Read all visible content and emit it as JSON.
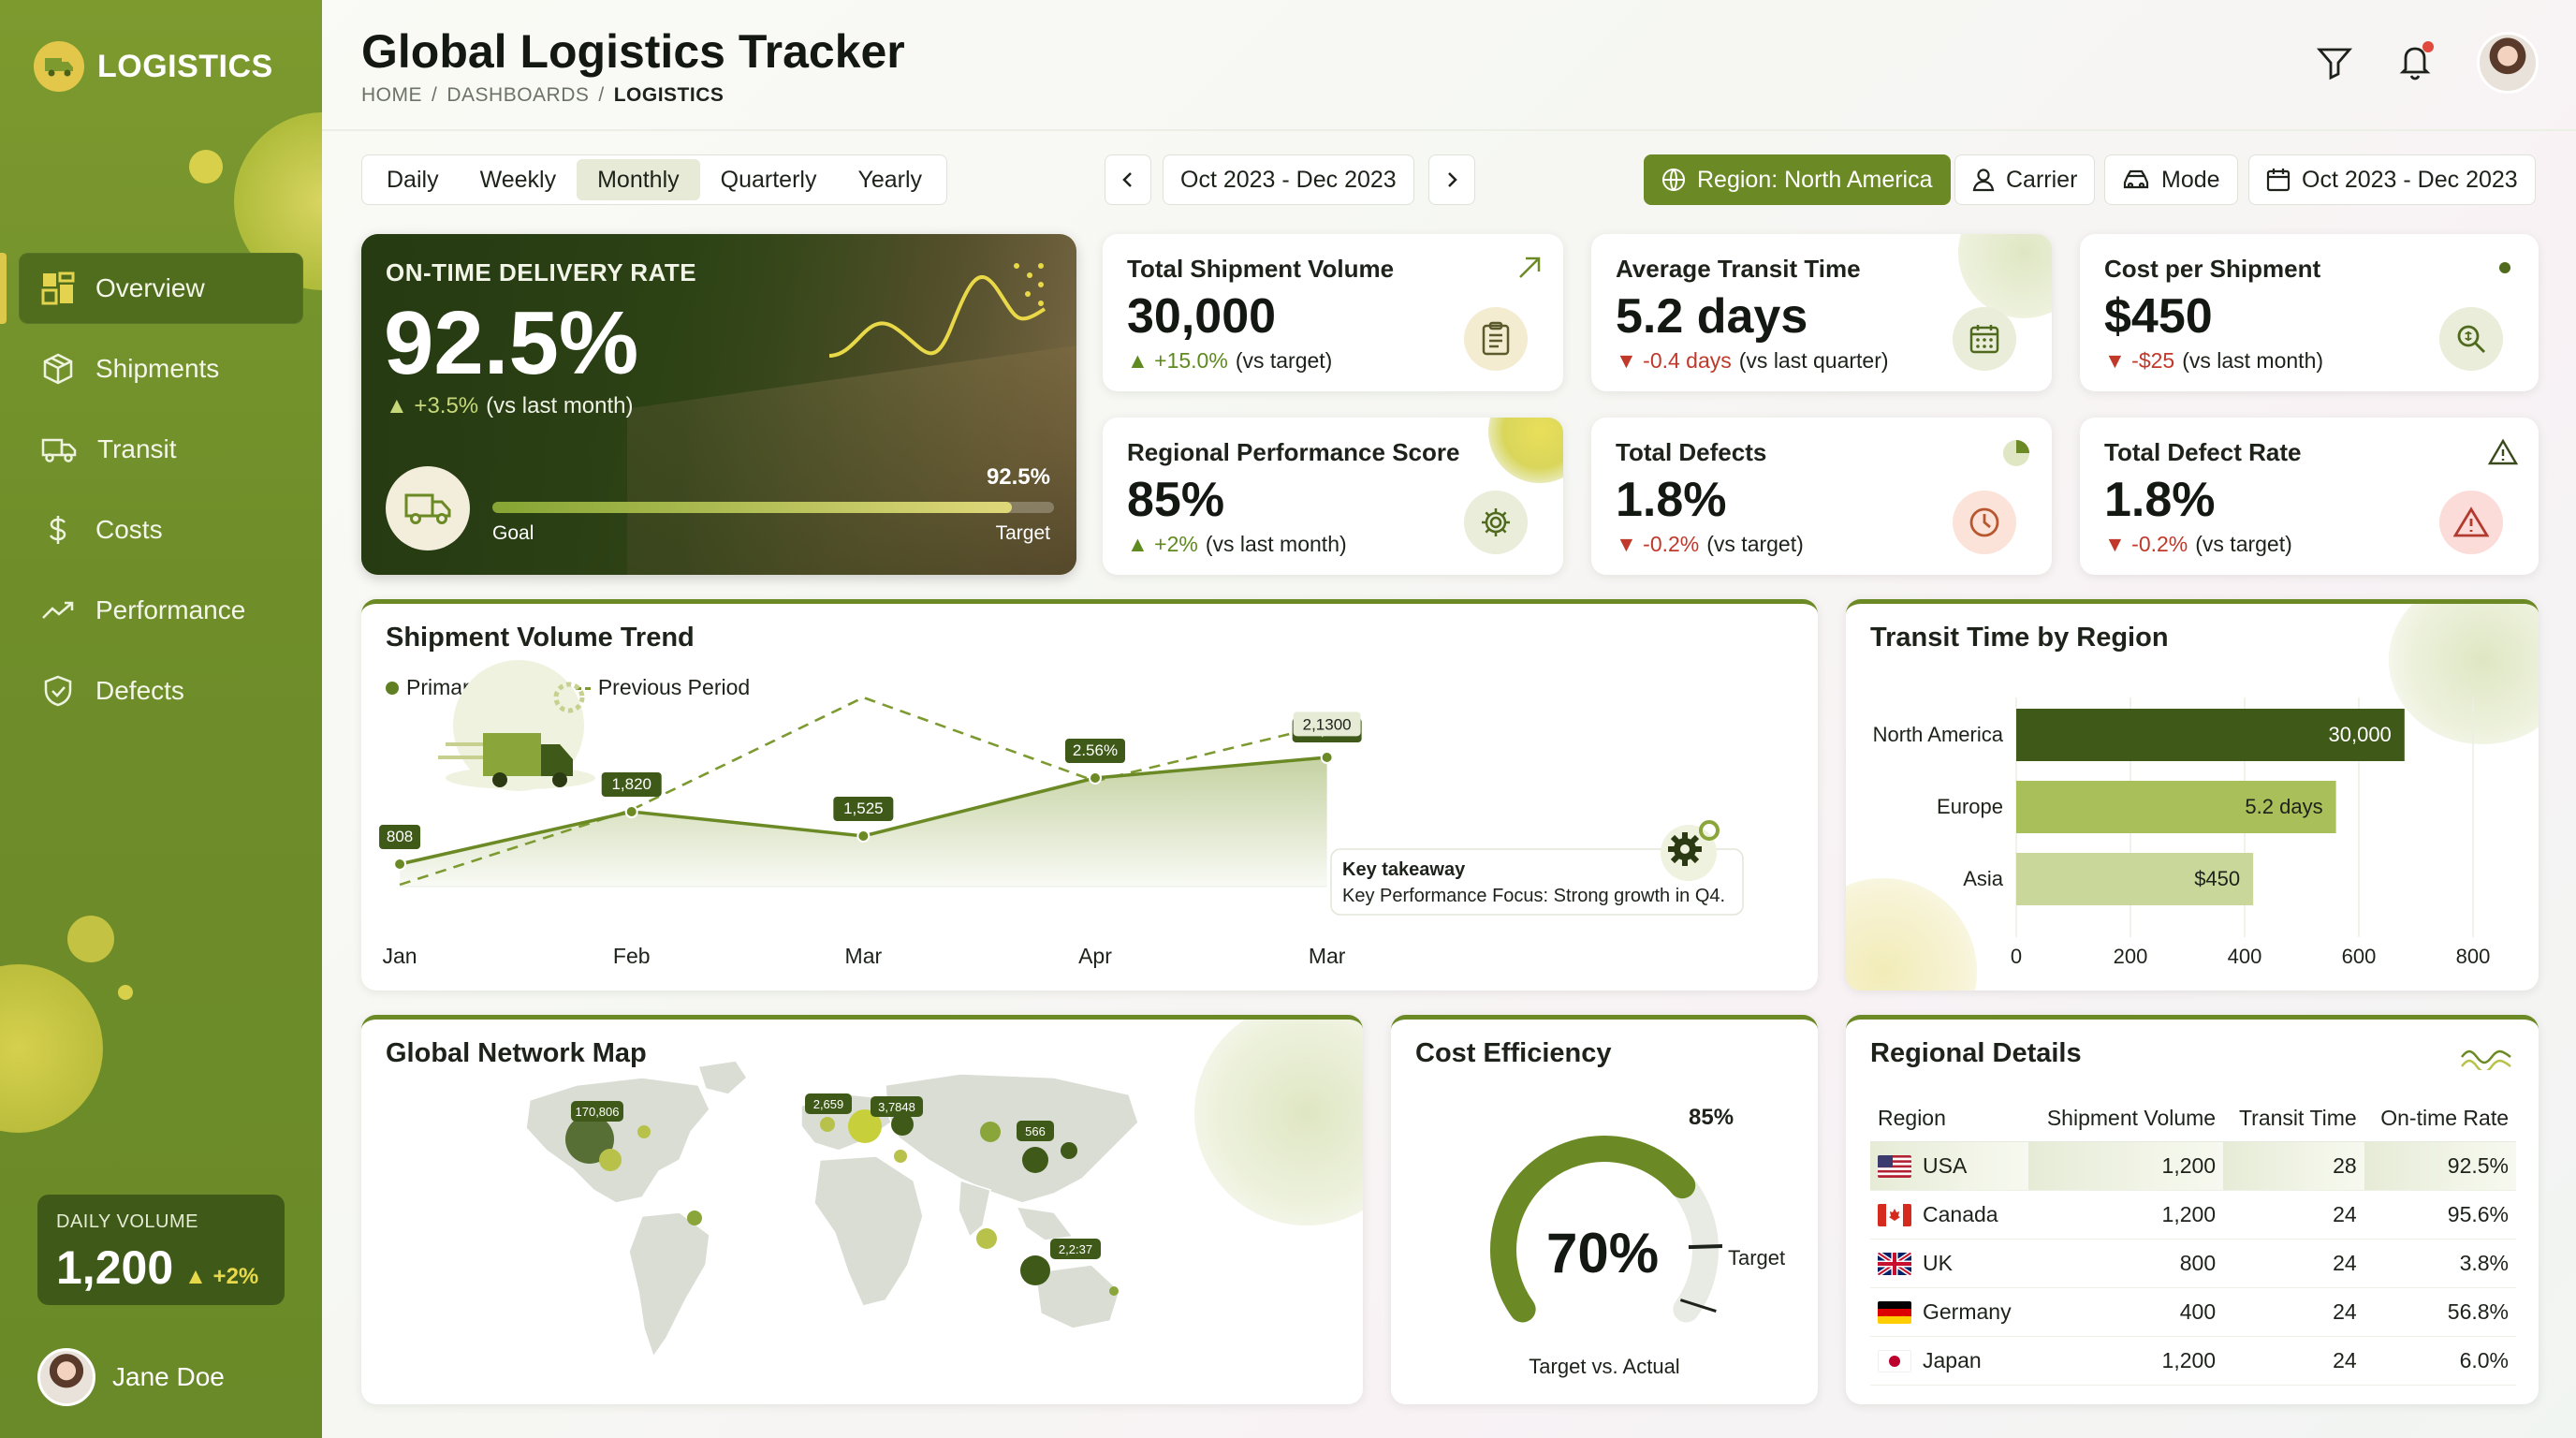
{
  "app": {
    "brand": "LOGISTICS",
    "title": "Global Logistics Tracker",
    "breadcrumb": [
      "HOME",
      "DASHBOARDS",
      "LOGISTICS"
    ]
  },
  "sidebar": {
    "items": [
      {
        "label": "Overview",
        "icon": "grid-icon",
        "active": true
      },
      {
        "label": "Shipments",
        "icon": "box-icon"
      },
      {
        "label": "Transit",
        "icon": "truck-icon"
      },
      {
        "label": "Costs",
        "icon": "dollar-icon"
      },
      {
        "label": "Performance",
        "icon": "trend-icon"
      },
      {
        "label": "Defects",
        "icon": "shield-icon"
      }
    ],
    "daily_volume": {
      "label": "DAILY VOLUME",
      "value": "1,200",
      "delta": "▲ +2%"
    },
    "user": {
      "name": "Jane Doe"
    }
  },
  "filters": {
    "periods": [
      "Daily",
      "Weekly",
      "Monthly",
      "Quarterly",
      "Yearly"
    ],
    "active_period": "Monthly",
    "date_range": "Oct 2023 - Dec 2023",
    "region": "Region: North America",
    "carrier": "Carrier",
    "mode": "Mode",
    "date_range_2": "Oct 2023 - Dec 2023"
  },
  "hero": {
    "title": "ON-TIME DELIVERY RATE",
    "value": "92.5%",
    "delta": "▲ +3.5%",
    "delta_note": "(vs last month)",
    "progress_pct": "92.5%",
    "progress_fraction": 0.925,
    "goal_label": "Goal",
    "target_label": "Target"
  },
  "kpis": {
    "shipment_volume": {
      "title": "Total Shipment Volume",
      "value": "30,000",
      "delta": "▲ +15.0%",
      "note": "(vs target)"
    },
    "transit_time": {
      "title": "Average Transit Time",
      "value": "5.2 days",
      "delta": "▼ -0.4 days",
      "note": "(vs last quarter)"
    },
    "cost_per_shipment": {
      "title": "Cost per Shipment",
      "value": "$450",
      "delta": "▼ -$25",
      "note": "(vs last month)"
    },
    "regional_score": {
      "title": "Regional Performance Score",
      "value": "85%",
      "delta": "▲ +2%",
      "note": "(vs last month)"
    },
    "total_defects": {
      "title": "Total Defects",
      "value": "1.8%",
      "delta": "▼ -0.2%",
      "note": "(vs target)"
    },
    "defect_rate": {
      "title": "Total Defect Rate",
      "value": "1.8%",
      "delta": "▼ -0.2%",
      "note": "(vs target)"
    }
  },
  "trend": {
    "title": "Shipment Volume Trend",
    "legend_primary": "Primary Series",
    "legend_previous": "Previous Period",
    "takeaway_title": "Key takeaway",
    "takeaway_text": "Key Performance Focus: Strong growth in Q4."
  },
  "transit_region": {
    "title": "Transit Time by Region"
  },
  "map": {
    "title": "Global Network Map",
    "labels": [
      "170,806",
      "2,659",
      "3,7848",
      "566",
      "2,2:37"
    ]
  },
  "cost_efficiency": {
    "title": "Cost Efficiency",
    "value": "70%",
    "value_fraction": 0.7,
    "target": "85%",
    "target_fraction": 0.85,
    "target_label": "Target",
    "caption": "Target vs. Actual"
  },
  "regional_details": {
    "title": "Regional Details",
    "columns": [
      "Region",
      "Shipment Volume",
      "Transit Time",
      "On-time Rate"
    ],
    "rows": [
      {
        "region": "USA",
        "volume": "1,200",
        "transit": "28",
        "rate": "92.5%",
        "flag": "us"
      },
      {
        "region": "Canada",
        "volume": "1,200",
        "transit": "24",
        "rate": "95.6%",
        "flag": "ca"
      },
      {
        "region": "UK",
        "volume": "800",
        "transit": "24",
        "rate": "3.8%",
        "flag": "uk"
      },
      {
        "region": "Germany",
        "volume": "400",
        "transit": "24",
        "rate": "56.8%",
        "flag": "de"
      },
      {
        "region": "Japan",
        "volume": "1,200",
        "transit": "24",
        "rate": "6.0%",
        "flag": "jp"
      }
    ]
  },
  "colors": {
    "primary": "#6b8a25",
    "dark": "#3f5a18",
    "accent": "#dcc84a",
    "up": "#5f8a1f",
    "down": "#c0392b"
  },
  "chart_data": [
    {
      "type": "line",
      "title": "Shipment Volume Trend",
      "categories": [
        "Jan",
        "Feb",
        "Mar",
        "Apr",
        "Mar"
      ],
      "series": [
        {
          "name": "Primary Series",
          "values": [
            808,
            1820,
            1525,
            2560,
            20000
          ],
          "labels": [
            "808",
            "1,820",
            "1,525",
            "2.56%",
            "20,000"
          ]
        },
        {
          "name": "Previous Period",
          "values": [
            850,
            1450,
            2350,
            1680,
            2130
          ],
          "end_label": "2,1300"
        }
      ]
    },
    {
      "type": "bar",
      "orientation": "horizontal",
      "title": "Transit Time by Region",
      "categories": [
        "North America",
        "Europe",
        "Asia"
      ],
      "values": [
        680,
        560,
        415
      ],
      "data_labels": [
        "30,000",
        "5.2 days",
        "$450"
      ],
      "xlim": [
        0,
        800
      ],
      "xticks": [
        "0",
        "200",
        "400",
        "600",
        "800"
      ]
    }
  ]
}
